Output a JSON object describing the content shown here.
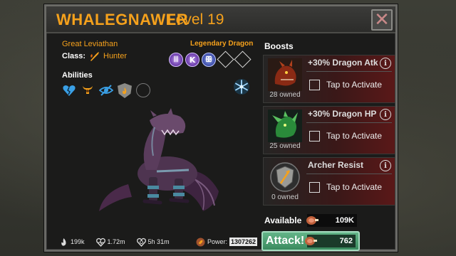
{
  "header": {
    "dragon_name": "WHALEGNAWER",
    "level_label": "Level 19"
  },
  "dragon": {
    "type": "Great Leviathan",
    "class_label": "Class:",
    "class_value": "Hunter",
    "rarity": "Legendary Dragon",
    "runes": [
      {
        "icon": "purple-rune-icon",
        "glyph": "ꔖ"
      },
      {
        "icon": "purple-k-rune-icon",
        "glyph": "K"
      },
      {
        "icon": "blue-rune-icon",
        "glyph": "ꕥ"
      }
    ],
    "empty_rune_slots": 2,
    "abilities_label": "Abilities",
    "abilities": [
      "broken-heart-icon",
      "bull-horns-icon",
      "eye-slash-icon",
      "shield-flame-icon",
      "empty-slot-icon"
    ],
    "element_icon": "frost-icon",
    "stats": {
      "attack": "199k",
      "health": "1.72m",
      "timer": "5h 31m",
      "power_label": "Power:",
      "power_value": "1307262"
    }
  },
  "boosts": {
    "label": "Boosts",
    "items": [
      {
        "name": "+30% Dragon Atk",
        "owned": "28 owned",
        "action": "Tap to Activate",
        "icon": "red-dragon-head-icon"
      },
      {
        "name": "+30% Dragon HP",
        "owned": "25 owned",
        "action": "Tap to Activate",
        "icon": "green-dragon-head-icon"
      },
      {
        "name": "Archer Resist",
        "owned": "0 owned",
        "action": "Tap to Activate",
        "icon": "shield-arrow-icon"
      }
    ]
  },
  "resources": {
    "available_label": "Available",
    "available_value": "109K",
    "attack_label": "Attack!",
    "attack_cost": "762"
  },
  "colors": {
    "accent_orange": "#f5a11c",
    "attack_green": "#4fa070",
    "boost_red": "#5a1818"
  }
}
